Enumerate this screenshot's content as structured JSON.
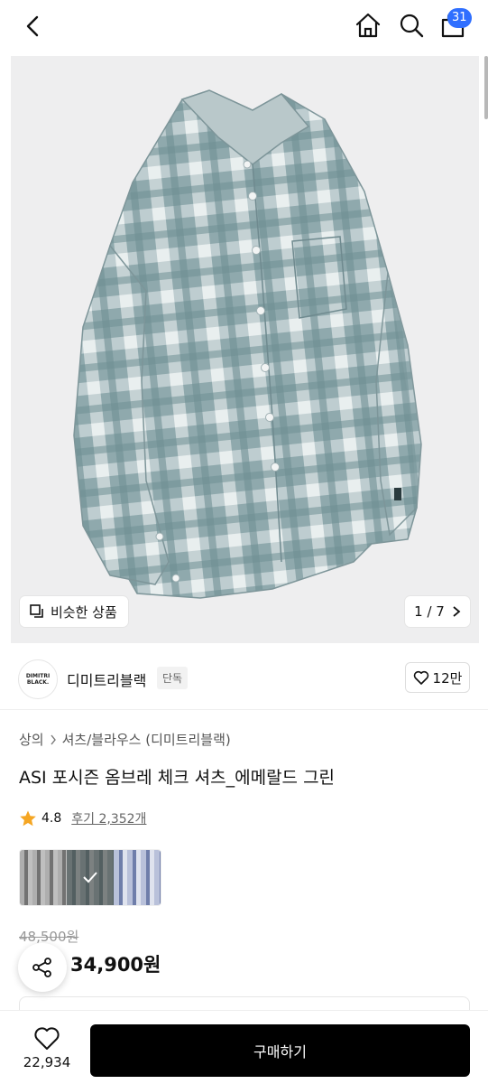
{
  "header": {
    "cart_count": "31"
  },
  "gallery": {
    "similar_label": "비슷한 상품",
    "page_indicator": "1 / 7"
  },
  "brand": {
    "logo_text_line1": "DIMITRI",
    "logo_text_line2": "BLACK.",
    "name": "디미트리블랙",
    "exclusive_badge": "단독",
    "like_count": "12만"
  },
  "product": {
    "breadcrumb": [
      "상의",
      "셔츠/블라우스 (디미트리블랙)"
    ],
    "title": "ASI 포시즌 옴브레 체크 셔츠_에메랄드 그린",
    "rating": "4.8",
    "review_label": "후기 2,352개",
    "color_options": [
      {
        "name": "gray-check",
        "color": "#b9b9b9",
        "selected": false
      },
      {
        "name": "emerald-green",
        "color": "#7f9a9a",
        "selected": true
      },
      {
        "name": "blue-check",
        "color": "#9fa9c6",
        "selected": false
      }
    ],
    "original_price": "48,500원",
    "sale_price": "34,900원"
  },
  "bottom_bar": {
    "wish_count": "22,934",
    "buy_label": "구매하기"
  },
  "colors": {
    "accent_badge": "#2f6fff",
    "star": "#f5a623",
    "buy_button": "#000000"
  }
}
